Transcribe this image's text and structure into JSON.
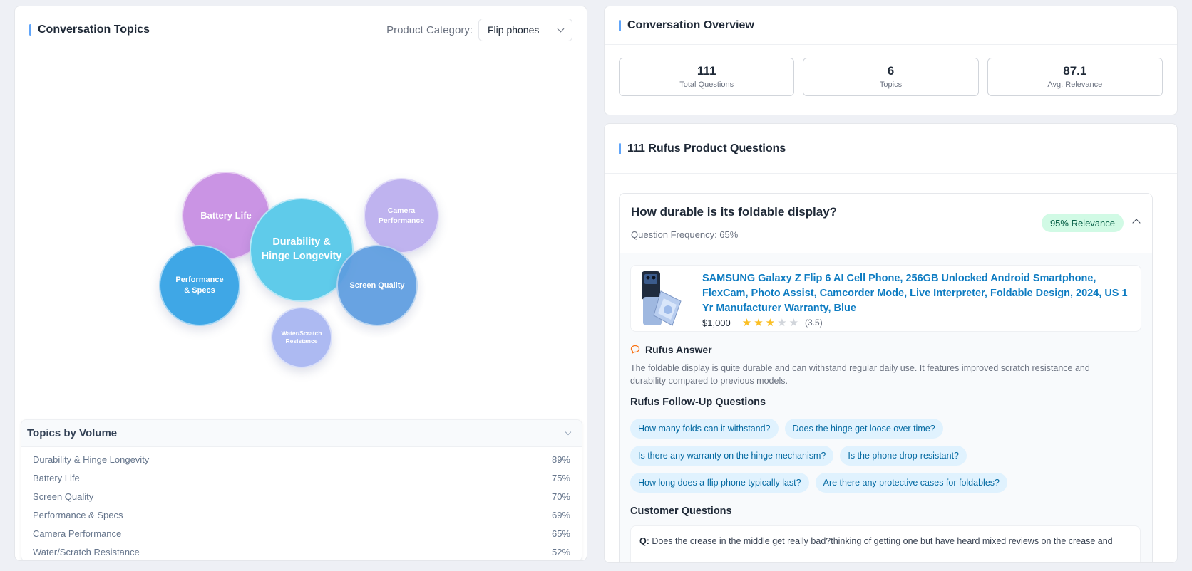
{
  "topics_panel": {
    "title": "Conversation Topics",
    "category_label": "Product Category:",
    "category_value": "Flip phones"
  },
  "bubbles": [
    {
      "label": "Battery Life",
      "color": "#c88fe3"
    },
    {
      "label": "Durability & Hinge Longevity",
      "color": "#5fcbea"
    },
    {
      "label": "Camera Performance",
      "color": "#bfb3ef"
    },
    {
      "label": "Performance & Specs",
      "color": "#3fa7e6"
    },
    {
      "label": "Screen Quality",
      "color": "#5d9de0"
    },
    {
      "label": "Water/Scratch Resistance",
      "color": "#adbaf2"
    }
  ],
  "topics_by_volume": {
    "title": "Topics by Volume",
    "rows": [
      {
        "name": "Durability & Hinge Longevity",
        "value": "89%"
      },
      {
        "name": "Battery Life",
        "value": "75%"
      },
      {
        "name": "Screen Quality",
        "value": "70%"
      },
      {
        "name": "Performance & Specs",
        "value": "69%"
      },
      {
        "name": "Camera Performance",
        "value": "65%"
      },
      {
        "name": "Water/Scratch Resistance",
        "value": "52%"
      }
    ]
  },
  "overview": {
    "title": "Conversation Overview",
    "stats": [
      {
        "value": "111",
        "caption": "Total Questions"
      },
      {
        "value": "6",
        "caption": "Topics"
      },
      {
        "value": "87.1",
        "caption": "Avg. Relevance"
      }
    ]
  },
  "questions": {
    "title": "111 Rufus Product Questions",
    "question": "How durable is its foldable display?",
    "frequency": "Question Frequency: 65%",
    "relevance": "95% Relevance",
    "product": {
      "title": "SAMSUNG Galaxy Z Flip 6 AI Cell Phone, 256GB Unlocked Android Smartphone, FlexCam, Photo Assist, Camcorder Mode, Live Interpreter, Foldable Design, 2024, US 1 Yr Manufacturer Warranty, Blue",
      "price": "$1,000",
      "rating": 3.5,
      "rating_text": "(3.5)"
    },
    "answer_label": "Rufus Answer",
    "answer": "The foldable display is quite durable and can withstand regular daily use. It features improved scratch resistance and durability compared to previous models.",
    "followup_label": "Rufus Follow-Up Questions",
    "followups": [
      "How many folds can it withstand?",
      "Does the hinge get loose over time?",
      "Is there any warranty on the hinge mechanism?",
      "Is the phone drop-resistant?",
      "How long does a flip phone typically last?",
      "Are there any protective cases for foldables?"
    ],
    "customer_label": "Customer Questions",
    "customer_q_prefix": "Q:",
    "customer_q": "Does the crease in the middle get really bad?thinking of getting one but have heard mixed reviews on the crease and"
  }
}
